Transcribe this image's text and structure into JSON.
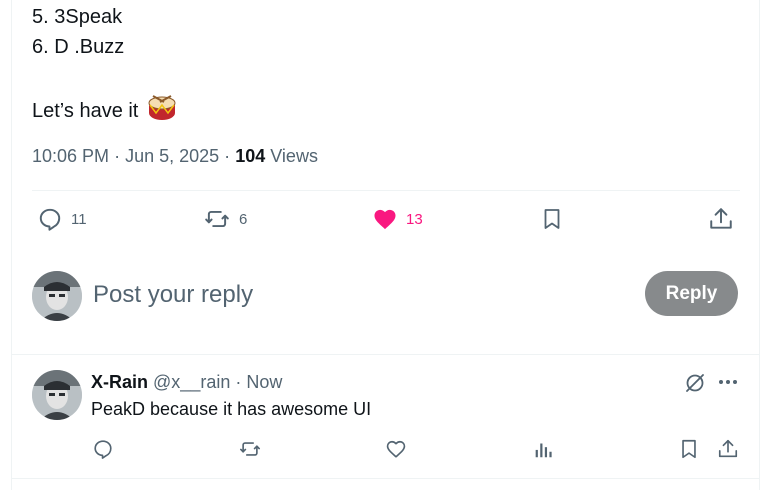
{
  "post": {
    "lines": [
      "5. 3Speak",
      "6. D .Buzz",
      "Let’s have it"
    ],
    "emoji_icon": "drum-emoji",
    "meta": {
      "time": "10:06 PM",
      "sep1": "·",
      "date": "Jun 5, 2025",
      "sep2": "·",
      "views_count": "104",
      "views_label": "Views"
    },
    "actions": {
      "replies": "11",
      "reposts": "6",
      "likes": "13",
      "like_color": "#f91880"
    }
  },
  "composer": {
    "placeholder": "Post your reply",
    "reply_label": "Reply",
    "reply_button_color": "#878a8c"
  },
  "reply": {
    "name": "X-Rain",
    "handle": "@x__rain",
    "sep": "·",
    "time": "Now",
    "text": "PeakD because it has awesome UI"
  },
  "colors": {
    "text_primary": "#0f1419",
    "text_secondary": "#536471",
    "border": "#eff3f4"
  }
}
